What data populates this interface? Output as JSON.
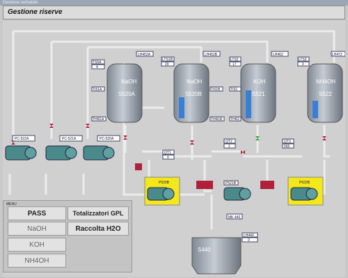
{
  "window": {
    "title": "Gestione serbatoio"
  },
  "header": {
    "title": "Gestione riserve"
  },
  "menu": {
    "title": "MENU",
    "buttons": {
      "pass": "PASS",
      "totalizzatori": "Totalizzatori GPL",
      "naoh": "NaOH",
      "raccolta": "Raccolta H2O",
      "koh": "KOH",
      "nh4oh": "NH4OH"
    }
  },
  "tanks": [
    {
      "name": "NaOH",
      "code": "S520A",
      "level_tag": "LH452A"
    },
    {
      "name": "NaOH",
      "code": "S520B",
      "level_tag": "LH452B"
    },
    {
      "name": "KOH",
      "code": "S521",
      "level_tag": "LH462"
    },
    {
      "name": "NH4OH",
      "code": "S522",
      "level_tag": "LH472"
    }
  ],
  "tank_tags": {
    "t1": "TS5A",
    "t1v": "4",
    "t2": "TI51A",
    "t3": "THR1A",
    "t4": "LTS1B",
    "t4v": "20",
    "t5": "TI51B",
    "t6": "THR1B",
    "t7": "LTS2",
    "t7v": "17",
    "t8": "TI52",
    "t9": "THR2",
    "t10": "LTS3",
    "t10v": "0"
  },
  "pumps": {
    "pc522a": "PC-522A",
    "pc521a": "PC-521A",
    "pc520a": "PC-520A",
    "p520": "P520B",
    "p521": "P521B",
    "p522": "P522B"
  },
  "flow": {
    "q1": "QT1",
    "q1v": "0",
    "q2": "QT2",
    "q2v": "2",
    "q3": "QT3",
    "q3v": "565"
  },
  "collector": {
    "name": "S440",
    "tag1": "MK 440",
    "tag2": "LH440",
    "tag2v": "0"
  },
  "colors": {
    "pipe": "#e8e8e8",
    "tank": "#9aa4b2",
    "valve": "#b0203a",
    "pump_highlight": "#f4e81a",
    "green_valve": "#2aa12a"
  }
}
